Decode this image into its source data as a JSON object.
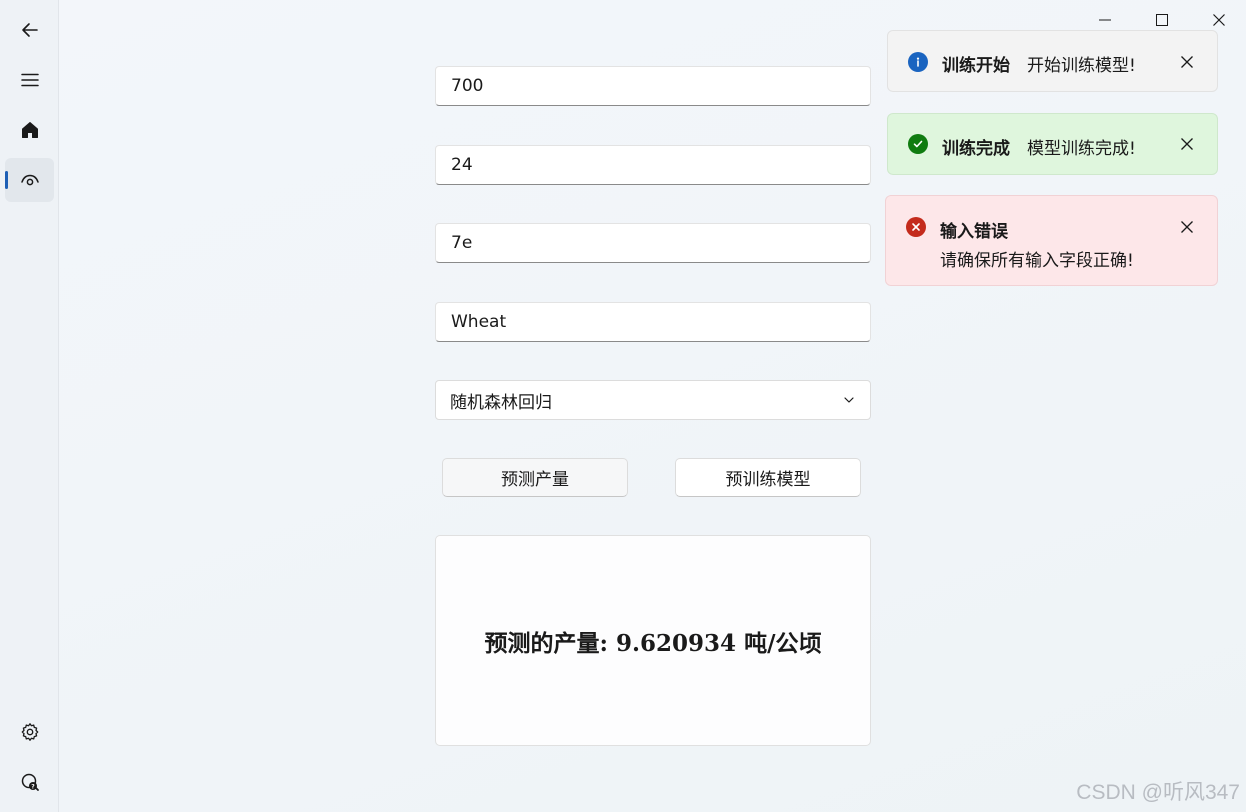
{
  "window": {
    "minimize_label": "minimize",
    "maximize_label": "maximize",
    "close_label": "close"
  },
  "sidebar": {
    "back_icon": "back-arrow-icon",
    "menu_icon": "hamburger-icon",
    "items": [
      {
        "name": "home",
        "icon": "home-icon"
      },
      {
        "name": "view",
        "icon": "eye-icon",
        "active": true
      }
    ],
    "footer_items": [
      {
        "name": "settings",
        "icon": "gear-icon"
      },
      {
        "name": "help",
        "icon": "help-search-icon"
      }
    ]
  },
  "form": {
    "field1_value": "700",
    "field2_value": "24",
    "field3_value": "7e",
    "field4_value": "Wheat",
    "model_select_value": "随机森林回归",
    "predict_button": "预测产量",
    "pretrain_button": "预训练模型"
  },
  "result": {
    "label": "预测的产量: 9.620934 吨/公顷"
  },
  "notifications": [
    {
      "type": "info",
      "title": "训练开始",
      "message": "开始训练模型!",
      "color": "#1a64c0",
      "bg": "#f3f3f3"
    },
    {
      "type": "success",
      "title": "训练完成",
      "message": "模型训练完成!",
      "color": "#107c10",
      "bg": "#dff6dd"
    },
    {
      "type": "error",
      "title": "输入错误",
      "message": "请确保所有输入字段正确!",
      "color": "#c42b1c",
      "bg": "#fde7e9"
    }
  ],
  "watermark": "CSDN @听风347"
}
